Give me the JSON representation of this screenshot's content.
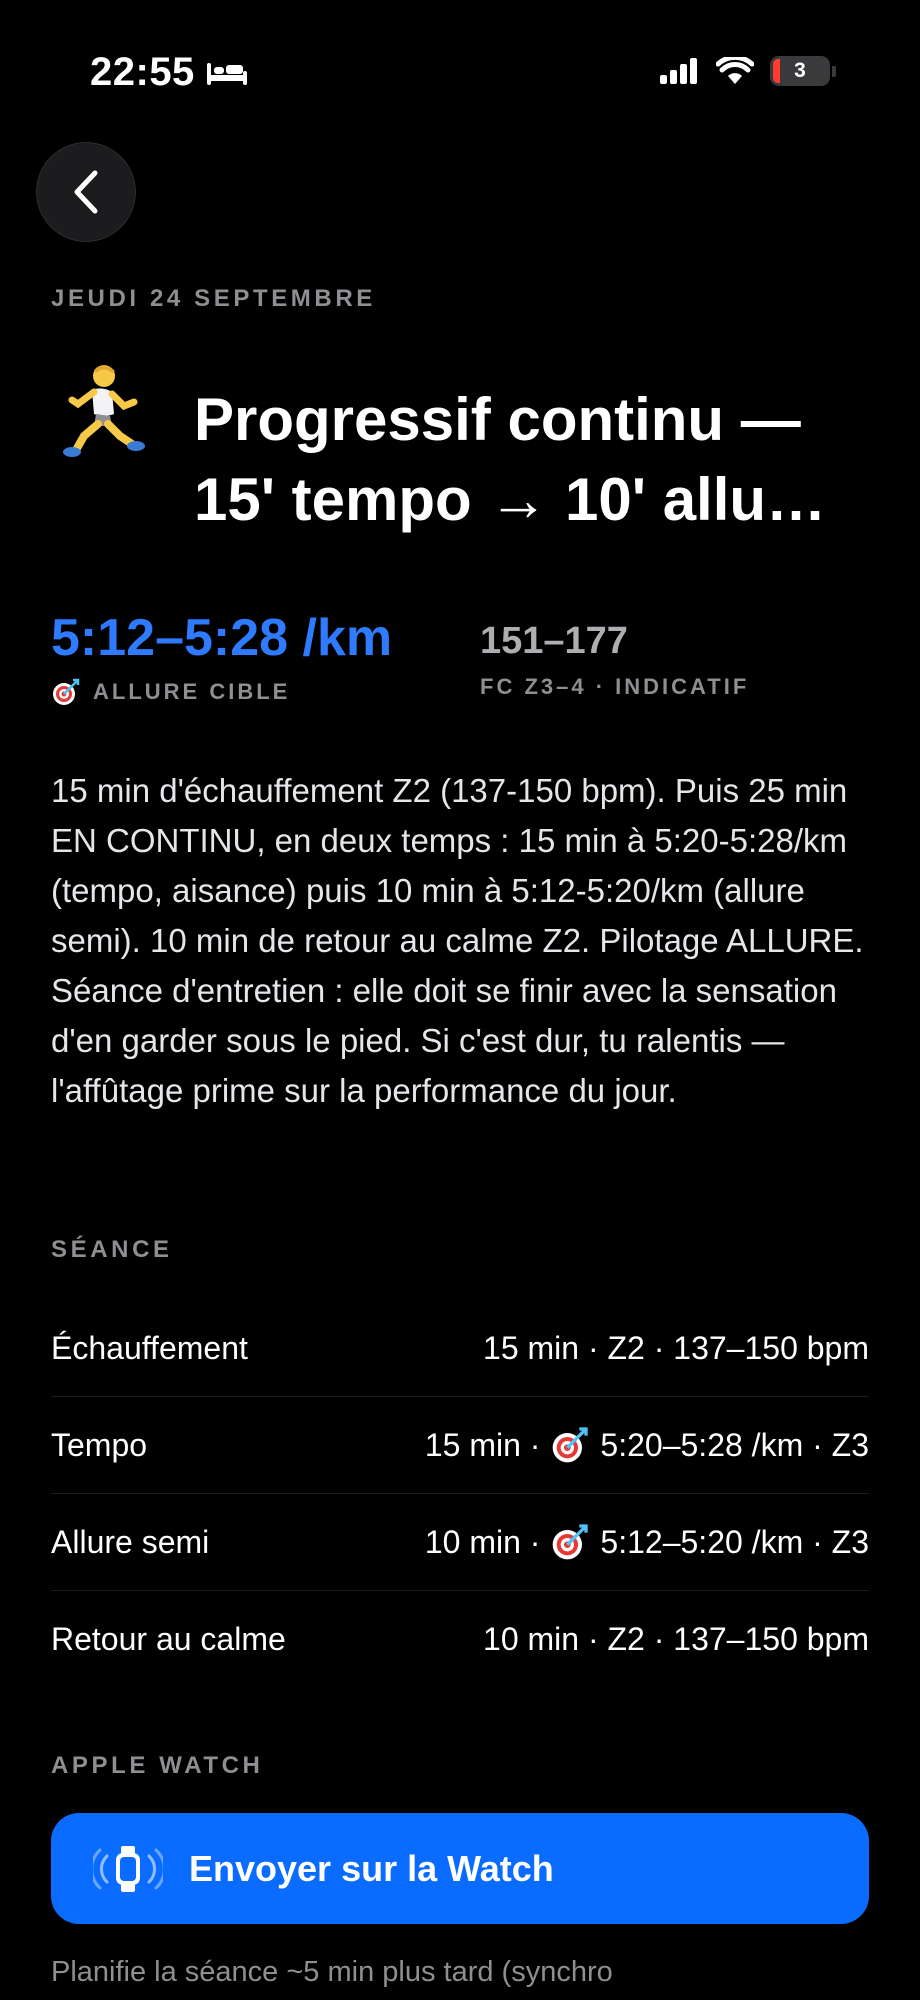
{
  "status_bar": {
    "time": "22:55",
    "battery": "3"
  },
  "header": {
    "date": "JEUDI 24 SEPTEMBRE",
    "title_line1": "Progressif continu —",
    "title_line2": "15' tempo → 10' allu…"
  },
  "targets": {
    "pace": "5:12–5:28 /km",
    "pace_label": "ALLURE CIBLE",
    "heart_rate": "151–177",
    "heart_rate_label": "FC Z3–4 · INDICATIF"
  },
  "description": "15 min d'échauffement Z2 (137-150 bpm). Puis 25 min EN CONTINU, en deux temps : 15 min à 5:20-5:28/km (tempo, aisance) puis 10 min à 5:12-5:20/km (allure semi). 10 min de retour au calme Z2. Pilotage ALLURE. Séance d'entretien : elle doit se finir avec la sensation d'en garder sous le pied. Si c'est dur, tu ralentis — l'affûtage prime sur la performance du jour.",
  "session": {
    "label": "SÉANCE",
    "rows": [
      {
        "name": "Échauffement",
        "pre": "15 min · Z2 · 137–150 bpm",
        "post": ""
      },
      {
        "name": "Tempo",
        "pre": "15 min ·",
        "post": "5:20–5:28 /km · Z3"
      },
      {
        "name": "Allure semi",
        "pre": "10 min ·",
        "post": "5:12–5:20 /km · Z3"
      },
      {
        "name": "Retour au calme",
        "pre": "10 min · Z2 · 137–150 bpm",
        "post": ""
      }
    ]
  },
  "watch": {
    "label": "APPLE WATCH",
    "button_label": "Envoyer sur la Watch",
    "footnote": "Planifie la séance ~5 min plus tard (synchro"
  },
  "colors": {
    "accent": "#2f7bff",
    "button": "#0a6cff",
    "muted": "#8e8e93"
  }
}
